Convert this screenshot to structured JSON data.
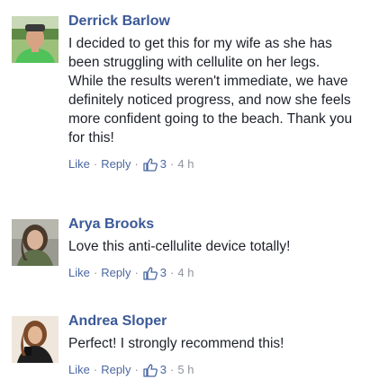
{
  "comments": [
    {
      "author": "Derrick Barlow",
      "text": "I decided to get this for my wife as she has been struggling with cellulite on her legs. While the results weren't immediate, we have definitely noticed progress, and now she feels more confident going to the beach. Thank you for this!",
      "like_label": "Like",
      "reply_label": "Reply",
      "like_count": "3",
      "time": "4 h"
    },
    {
      "author": "Arya Brooks",
      "text": "Love this anti-cellulite device totally!",
      "like_label": "Like",
      "reply_label": "Reply",
      "like_count": "3",
      "time": "4 h"
    },
    {
      "author": "Andrea Sloper",
      "text": "Perfect! I strongly recommend this!",
      "like_label": "Like",
      "reply_label": "Reply",
      "like_count": "3",
      "time": "5 h"
    }
  ],
  "separator": "·",
  "icons": {
    "reaction": "thumbs-up-icon"
  },
  "colors": {
    "name": "#3b5998",
    "link": "#4b67a1",
    "meta": "#90949c",
    "text": "#1d2129"
  }
}
